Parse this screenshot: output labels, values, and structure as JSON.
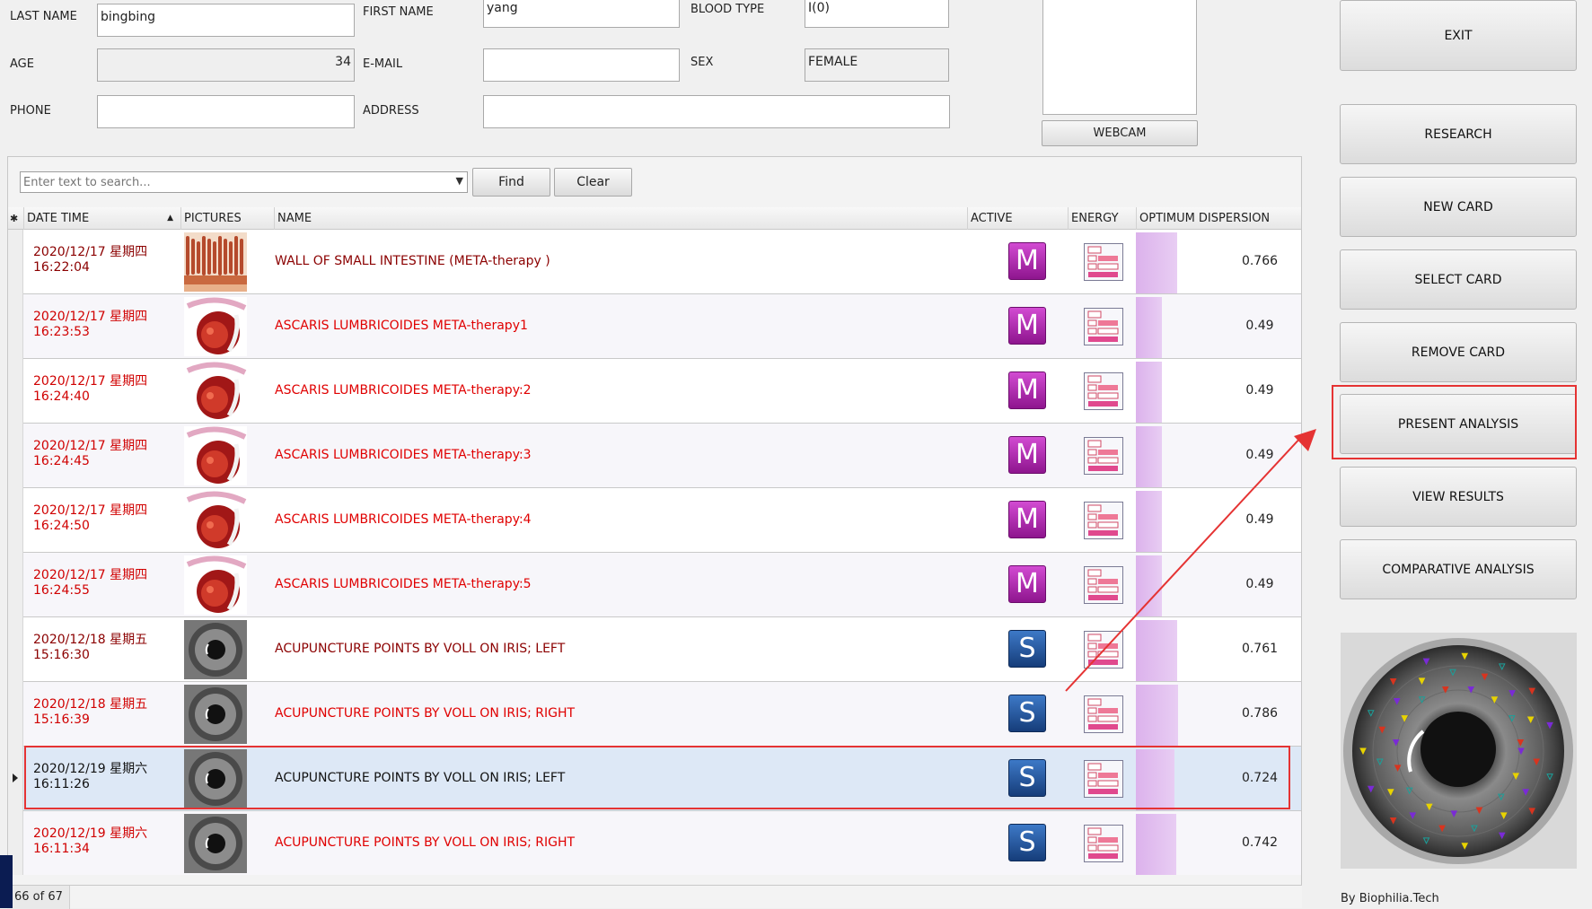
{
  "patient": {
    "last_name_label": "LAST NAME",
    "last_name": "bingbing",
    "first_name_label": "FIRST NAME",
    "first_name": "yang",
    "blood_type_label": "BLOOD TYPE",
    "blood_type": "I(0)",
    "age_label": "AGE",
    "age": "34",
    "email_label": "E-MAIL",
    "email": "",
    "sex_label": "SEX",
    "sex": "FEMALE",
    "phone_label": "PHONE",
    "phone": "",
    "address_label": "ADDRESS",
    "address": ""
  },
  "webcam": {
    "button_label": "WEBCAM"
  },
  "search": {
    "placeholder": "Enter text to search...",
    "find_label": "Find",
    "clear_label": "Clear"
  },
  "grid": {
    "columns": {
      "marker": "✱",
      "datetime": "DATE TIME",
      "pictures": "PICTURES",
      "name": "NAME",
      "active": "ACTIVE",
      "energy": "ENERGY",
      "optimum": "OPTIMUM DISPERSION"
    },
    "rows": [
      {
        "date": "2020/12/17 星期四",
        "time": "16:22:04",
        "picture": "intestine",
        "name": "WALL OF SMALL  INTESTINE (META-therapy )",
        "active": "M",
        "optimum": "0.766",
        "optimum_fill": 0.766,
        "tone": "dark"
      },
      {
        "date": "2020/12/17 星期四",
        "time": "16:23:53",
        "picture": "ascaris",
        "name": "ASCARIS  LUMBRICOIDES META-therapy1",
        "active": "M",
        "optimum": "0.49",
        "optimum_fill": 0.49,
        "tone": "red"
      },
      {
        "date": "2020/12/17 星期四",
        "time": "16:24:40",
        "picture": "ascaris",
        "name": "ASCARIS  LUMBRICOIDES META-therapy:2",
        "active": "M",
        "optimum": "0.49",
        "optimum_fill": 0.49,
        "tone": "red"
      },
      {
        "date": "2020/12/17 星期四",
        "time": "16:24:45",
        "picture": "ascaris",
        "name": "ASCARIS  LUMBRICOIDES META-therapy:3",
        "active": "M",
        "optimum": "0.49",
        "optimum_fill": 0.49,
        "tone": "red"
      },
      {
        "date": "2020/12/17 星期四",
        "time": "16:24:50",
        "picture": "ascaris",
        "name": "ASCARIS  LUMBRICOIDES META-therapy:4",
        "active": "M",
        "optimum": "0.49",
        "optimum_fill": 0.49,
        "tone": "red"
      },
      {
        "date": "2020/12/17 星期四",
        "time": "16:24:55",
        "picture": "ascaris",
        "name": "ASCARIS  LUMBRICOIDES META-therapy:5",
        "active": "M",
        "optimum": "0.49",
        "optimum_fill": 0.49,
        "tone": "red"
      },
      {
        "date": "2020/12/18 星期五",
        "time": "15:16:30",
        "picture": "iris",
        "name": "ACUPUNCTURE POINTS BY VOLL ON IRIS; LEFT",
        "active": "S",
        "optimum": "0.761",
        "optimum_fill": 0.761,
        "tone": "dark"
      },
      {
        "date": "2020/12/18 星期五",
        "time": "15:16:39",
        "picture": "iris",
        "name": "ACUPUNCTURE POINTS BY VOLL ON IRIS; RIGHT",
        "active": "S",
        "optimum": "0.786",
        "optimum_fill": 0.786,
        "tone": "red"
      },
      {
        "date": "2020/12/19 星期六",
        "time": "16:11:26",
        "picture": "iris",
        "name": "ACUPUNCTURE POINTS BY VOLL ON IRIS; LEFT",
        "active": "S",
        "optimum": "0.724",
        "optimum_fill": 0.724,
        "tone": "selected"
      },
      {
        "date": "2020/12/19 星期六",
        "time": "16:11:34",
        "picture": "iris",
        "name": "ACUPUNCTURE POINTS BY VOLL ON IRIS; RIGHT",
        "active": "S",
        "optimum": "0.742",
        "optimum_fill": 0.742,
        "tone": "red"
      }
    ]
  },
  "status": {
    "record_position": "66 of 67"
  },
  "sidebar": {
    "exit": "EXIT",
    "research": "RESEARCH",
    "new_card": "NEW CARD",
    "select_card": "SELECT CARD",
    "remove_card": "REMOVE CARD",
    "present_analysis": "PRESENT ANALYSIS",
    "view_results": "VIEW RESULTS",
    "comparative_analysis": "COMPARATIVE ANALYSIS",
    "brand": "By Biophilia.Tech"
  },
  "colors": {
    "annotation": "#e53333",
    "m_badge": "#a020a0",
    "s_badge": "#1f4f94",
    "optimum_bar": "#dcb2ec"
  }
}
